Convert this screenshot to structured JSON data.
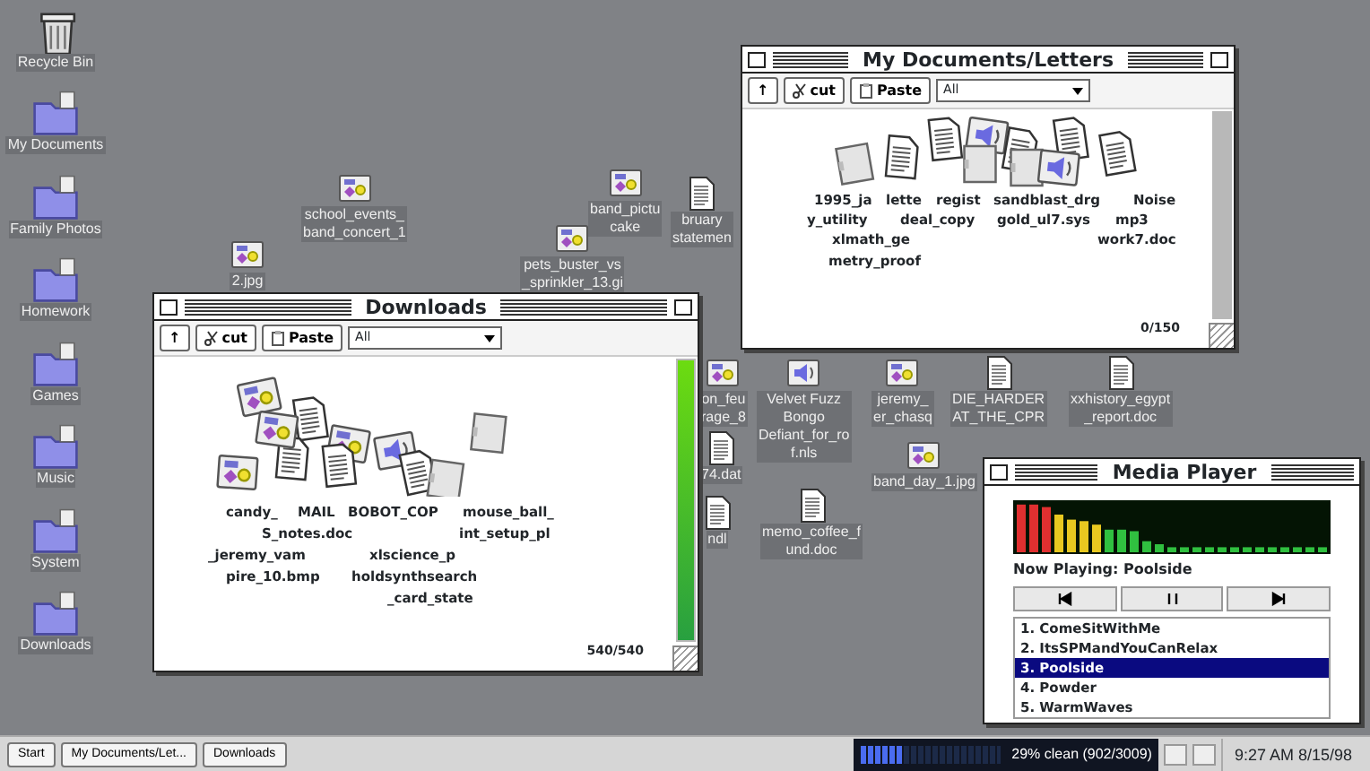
{
  "desktop_icons": [
    {
      "label": "Recycle Bin",
      "kind": "trash"
    },
    {
      "label": "My Documents",
      "kind": "folder"
    },
    {
      "label": "Family Photos",
      "kind": "folder"
    },
    {
      "label": "Homework",
      "kind": "folder"
    },
    {
      "label": "Games",
      "kind": "folder"
    },
    {
      "label": "Music",
      "kind": "folder"
    },
    {
      "label": "System",
      "kind": "folder"
    },
    {
      "label": "Downloads",
      "kind": "folder"
    }
  ],
  "scattered_files": [
    {
      "label": "school_events_ band_concert_1",
      "kind": "image"
    },
    {
      "label": "2.jpg",
      "kind": "image"
    },
    {
      "label": "pets_buster_vs _sprinkler_13.gi",
      "kind": "image"
    },
    {
      "label": "band_pictu cake",
      "kind": "image"
    },
    {
      "label": "bruary statemen",
      "kind": "doc"
    },
    {
      "label": "on_feu rage_8",
      "kind": "image"
    },
    {
      "label": "Velvet Fuzz Bongo Defiant_for_ro f.nls",
      "kind": "audio"
    },
    {
      "label": "jeremy_ er_chasq",
      "kind": "image"
    },
    {
      "label": "DIE_HARDER AT_THE_CPR",
      "kind": "doc"
    },
    {
      "label": "band_day_1.jpg",
      "kind": "image"
    },
    {
      "label": "memo_coffee_f und.doc",
      "kind": "doc"
    },
    {
      "label": "xxhistory_egypt _report.doc",
      "kind": "doc"
    },
    {
      "label": "74.dat",
      "kind": "doc"
    },
    {
      "label": "ndl",
      "kind": "doc"
    }
  ],
  "windows": [
    {
      "title": "Downloads",
      "toolbar": {
        "up": "↑",
        "cut": "cut",
        "paste": "Paste",
        "filter": "All"
      },
      "pile_labels": [
        "candy_",
        "MAIL",
        "BOBOT_COP",
        "mouse_ball_",
        "S_notes.doc",
        "int_setup_pl",
        "_jeremy_vam",
        "xlscience_p",
        "pire_10.bmp",
        "holdsynthsearch",
        "_card_state"
      ],
      "count": "540/540",
      "progress": {
        "level": 1
      }
    },
    {
      "title": "My Documents/Letters",
      "toolbar": {
        "up": "↑",
        "cut": "cut",
        "paste": "Paste",
        "filter": "All"
      },
      "pile_labels": [
        "1995_ja",
        "lette",
        "regist",
        "sandblast_drg",
        "Noise",
        "y_utility",
        "deal_copy",
        "gold_ul7.sys",
        "mp3",
        "xlmath_ge",
        "work7.doc",
        "metry_proof"
      ],
      "count": "0/150",
      "progress": {
        "level": 0
      }
    }
  ],
  "media_player": {
    "title": "Media Player",
    "now_playing": "Now Playing: Poolside",
    "playlist": [
      {
        "label": "1. ComeSitWithMe",
        "selected": false
      },
      {
        "label": "2. ItsSPMandYouCanRelax",
        "selected": false
      },
      {
        "label": "3. Poolside",
        "selected": true
      },
      {
        "label": "4. Powder",
        "selected": false
      },
      {
        "label": "5. WarmWaves",
        "selected": false
      }
    ]
  },
  "taskbar": {
    "start": "Start",
    "tasks": [
      "My Documents/Let...",
      "Downloads"
    ],
    "meter": {
      "text": "29% clean (902/3009)",
      "level": 0.29
    },
    "clock": "9:27 AM 8/15/98"
  }
}
